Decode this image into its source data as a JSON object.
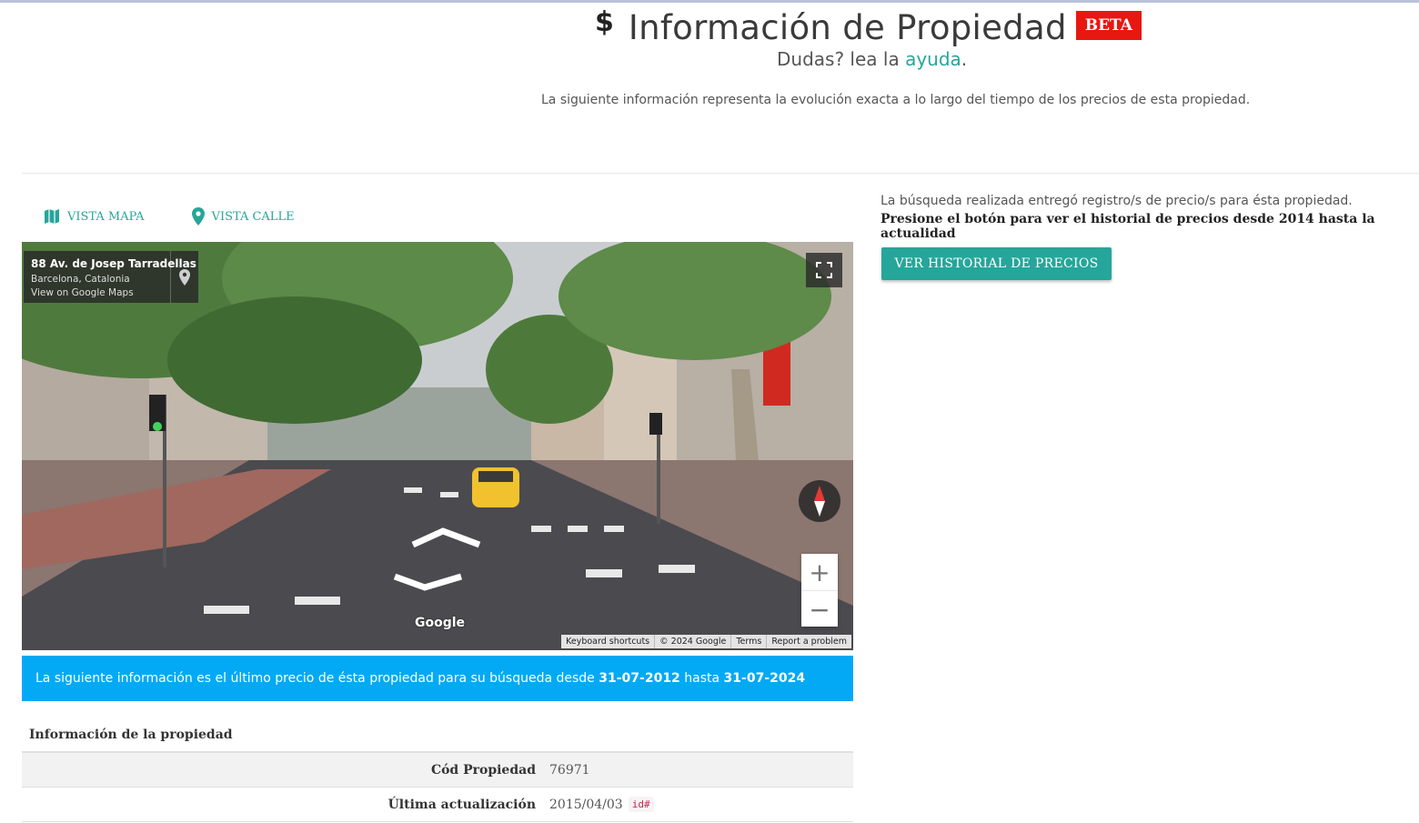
{
  "header": {
    "title": "Información de Propiedad",
    "badge": "BETA",
    "subtitle_prefix": "Dudas? lea la ",
    "help_link": "ayuda",
    "subtitle_suffix": ".",
    "description": "La siguiente información representa la evolución exacta a lo largo del tiempo de los precios de esta propiedad."
  },
  "tabs": {
    "map": "VISTA MAPA",
    "street": "VISTA CALLE"
  },
  "streetview": {
    "address": "88 Av. de Josep Tarradellas",
    "city": "Barcelona, Catalonia",
    "maps_link": "View on Google Maps",
    "logo": "Google",
    "attribution": [
      "Keyboard shortcuts",
      "© 2024 Google",
      "Terms",
      "Report a problem"
    ],
    "zoom_in": "+",
    "zoom_out": "−"
  },
  "info_bar": {
    "text_prefix": "La siguiente información es el último precio de ésta propiedad para su búsqueda desde ",
    "date_from": "31-07-2012",
    "text_middle": " hasta ",
    "date_to": "31-07-2024"
  },
  "property": {
    "heading": "Información de la propiedad",
    "rows": [
      {
        "label": "Cód Propiedad",
        "value": "76971"
      },
      {
        "label": "Última actualización",
        "value": "2015/04/03",
        "tag": "id#"
      }
    ]
  },
  "sidebar": {
    "line1": "La búsqueda realizada entregó registro/s de precio/s para ésta propiedad.",
    "line2": "Presione el botón para ver el historial de precios desde 2014 hasta la actualidad",
    "button": "VER HISTORIAL DE PRECIOS"
  },
  "colors": {
    "accent": "#26a69a",
    "badge": "#e8170f",
    "info_bar": "#03a9f4"
  }
}
